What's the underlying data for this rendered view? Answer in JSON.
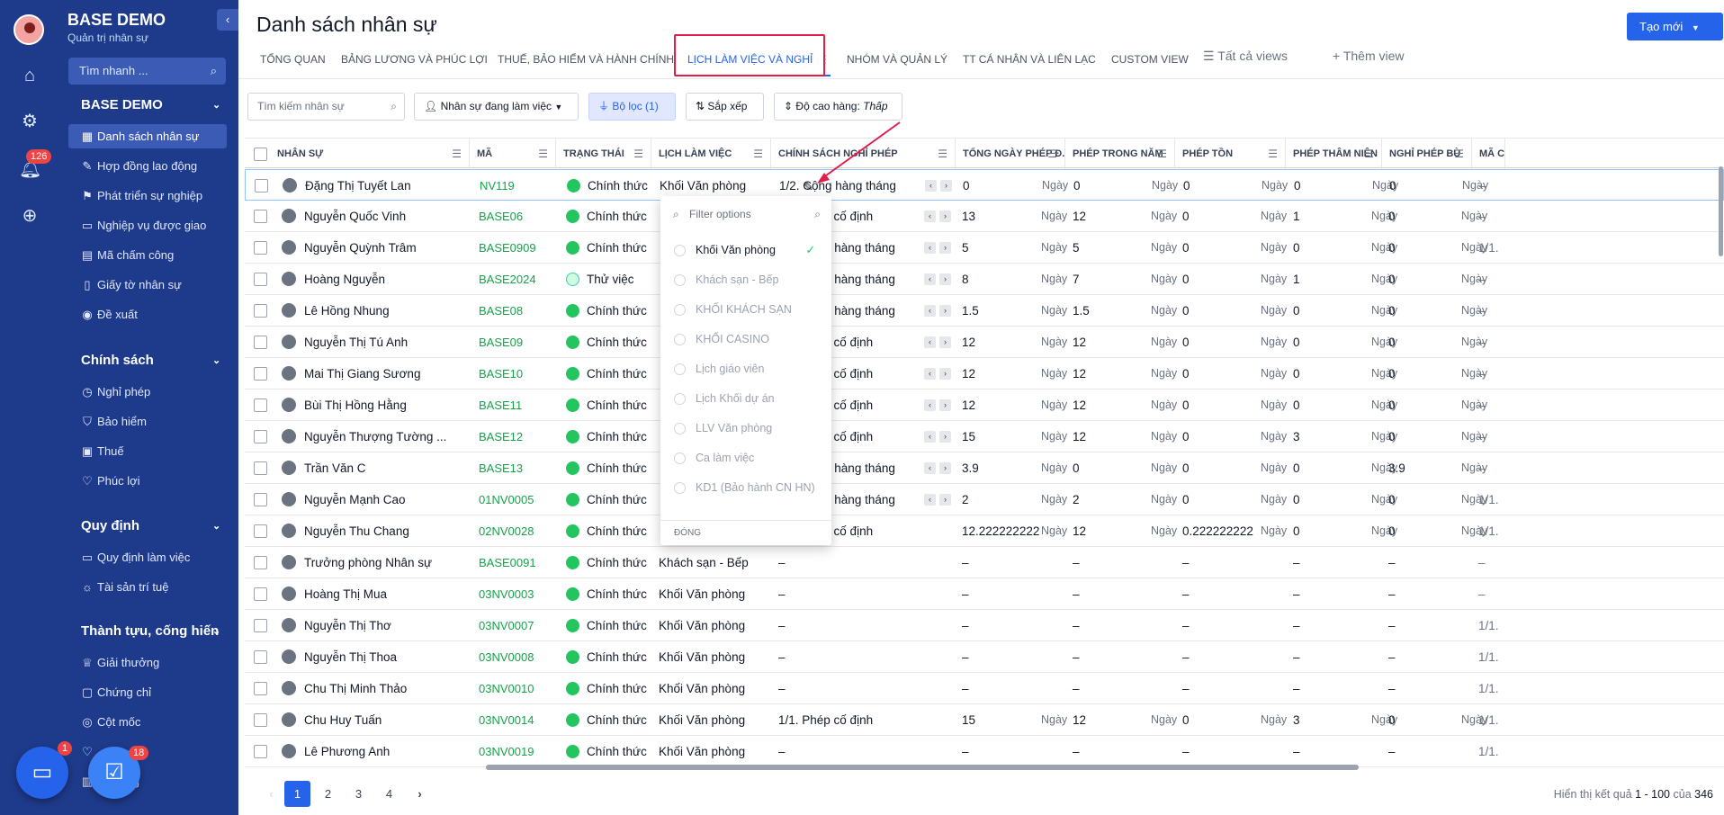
{
  "app": {
    "name": "BASE DEMO",
    "subtitle": "Quản trị nhân sự"
  },
  "rail": {
    "notification_count": "126"
  },
  "sidebar": {
    "search_placeholder": "Tìm nhanh ...",
    "sections": [
      {
        "title": "BASE DEMO",
        "items": [
          {
            "label": "Danh sách nhân sự",
            "icon": "grid-icon",
            "active": true
          },
          {
            "label": "Hợp đồng lao động",
            "icon": "contract-icon"
          },
          {
            "label": "Phát triển sự nghiệp",
            "icon": "flag-icon"
          },
          {
            "label": "Nghiệp vụ được giao",
            "icon": "book-icon"
          },
          {
            "label": "Mã chấm công",
            "icon": "calendar-icon"
          },
          {
            "label": "Giấy tờ nhân sự",
            "icon": "document-icon"
          },
          {
            "label": "Đề xuất",
            "icon": "broadcast-icon"
          }
        ]
      },
      {
        "title": "Chính sách",
        "items": [
          {
            "label": "Nghỉ phép",
            "icon": "clock-icon"
          },
          {
            "label": "Bảo hiểm",
            "icon": "shield-icon"
          },
          {
            "label": "Thuế",
            "icon": "wallet-icon"
          },
          {
            "label": "Phúc lợi",
            "icon": "heart-icon"
          }
        ]
      },
      {
        "title": "Quy định",
        "items": [
          {
            "label": "Quy định làm việc",
            "icon": "book-icon"
          },
          {
            "label": "Tài sản trí tuệ",
            "icon": "idea-icon"
          }
        ]
      },
      {
        "title": "Thành tựu, cống hiến",
        "items": [
          {
            "label": "Giải thưởng",
            "icon": "crown-icon"
          },
          {
            "label": "Chứng chỉ",
            "icon": "certificate-icon"
          },
          {
            "label": "Cột mốc",
            "icon": "target-icon"
          },
          {
            "label": "",
            "icon": "heart-icon"
          },
          {
            "label": "ếp hạng",
            "icon": "ranking-icon"
          }
        ]
      }
    ],
    "fab_chat_badge": "1",
    "fab_task_badge": "18"
  },
  "page": {
    "title": "Danh sách nhân sự",
    "create_label": "Tạo mới"
  },
  "tabs": [
    {
      "label": "TỔNG QUAN"
    },
    {
      "label": "BẢNG LƯƠNG VÀ PHÚC LỢI"
    },
    {
      "label": "THUẾ, BẢO HIỂM VÀ HÀNH CHÍNH"
    },
    {
      "label": "LỊCH LÀM VIỆC VÀ NGHỈ",
      "active": true
    },
    {
      "label": "NHÓM VÀ QUẢN LÝ"
    },
    {
      "label": "TT CÁ NHÂN VÀ LIÊN LẠC"
    },
    {
      "label": "CUSTOM VIEW"
    },
    {
      "label": "Tất cả views"
    },
    {
      "label": "Thêm view"
    }
  ],
  "toolbar": {
    "search_placeholder": "Tìm kiếm nhân sự",
    "status_filter": "Nhân sự đang làm việc",
    "filter_label": "Bộ lọc (1)",
    "sort_label": "Sắp xếp",
    "row_height_label": "Độ cao hàng:",
    "row_height_value": "Thấp"
  },
  "columns": [
    "NHÂN SỰ",
    "MÃ",
    "TRẠNG THÁI",
    "LỊCH LÀM VIỆC",
    "CHÍNH SÁCH NGHỈ PHÉP",
    "TỔNG NGÀY PHÉP Đ...",
    "PHÉP TRONG NĂM",
    "PHÉP TỒN",
    "PHÉP THÂM NIÊN",
    "NGHỈ PHÉP BÙ",
    "MÃ C"
  ],
  "unit_label": "Ngày",
  "rows": [
    {
      "name": "Đặng Thị Tuyết Lan",
      "code": "NV119",
      "status": "Chính thức",
      "schedule": "Khối Văn phòng",
      "policy": "1/2. Cộng hàng tháng",
      "total": "0",
      "year": "0",
      "remain": "0",
      "senior": "0",
      "comp": "0",
      "extra": "–"
    },
    {
      "name": "Nguyễn Quốc Vinh",
      "code": "BASE06",
      "status": "Chính thức",
      "schedule": "",
      "policy": "1/2. Phép cố định",
      "total": "13",
      "year": "12",
      "remain": "0",
      "senior": "1",
      "comp": "0",
      "extra": "–"
    },
    {
      "name": "Nguyễn Quỳnh Trâm",
      "code": "BASE0909",
      "status": "Chính thức",
      "schedule": "",
      "policy": "1/2. Cộng hàng tháng",
      "total": "5",
      "year": "5",
      "remain": "0",
      "senior": "0",
      "comp": "0",
      "extra": "1/1."
    },
    {
      "name": "Hoàng Nguyễn",
      "code": "BASE2024",
      "status": "Thử việc",
      "schedule": "",
      "policy": "1/2. Cộng hàng tháng",
      "total": "8",
      "year": "7",
      "remain": "0",
      "senior": "1",
      "comp": "0",
      "extra": "–"
    },
    {
      "name": "Lê Hồng Nhung",
      "code": "BASE08",
      "status": "Chính thức",
      "schedule": "",
      "policy": "1/2. Cộng hàng tháng",
      "total": "1.5",
      "year": "1.5",
      "remain": "0",
      "senior": "0",
      "comp": "0",
      "extra": "–"
    },
    {
      "name": "Nguyễn Thị Tú Anh",
      "code": "BASE09",
      "status": "Chính thức",
      "schedule": "",
      "policy": "1/2. Phép cố định",
      "total": "12",
      "year": "12",
      "remain": "0",
      "senior": "0",
      "comp": "0",
      "extra": "–"
    },
    {
      "name": "Mai Thị Giang Sương",
      "code": "BASE10",
      "status": "Chính thức",
      "schedule": "",
      "policy": "1/2. Phép cố định",
      "total": "12",
      "year": "12",
      "remain": "0",
      "senior": "0",
      "comp": "0",
      "extra": "–"
    },
    {
      "name": "Bùi Thị Hồng Hằng",
      "code": "BASE11",
      "status": "Chính thức",
      "schedule": "",
      "policy": "1/2. Phép cố định",
      "total": "12",
      "year": "12",
      "remain": "0",
      "senior": "0",
      "comp": "0",
      "extra": "–"
    },
    {
      "name": "Nguyễn Thượng Tường ...",
      "code": "BASE12",
      "status": "Chính thức",
      "schedule": "",
      "policy": "1/2. Phép cố định",
      "total": "15",
      "year": "12",
      "remain": "0",
      "senior": "3",
      "comp": "0",
      "extra": "–"
    },
    {
      "name": "Trần Văn C",
      "code": "BASE13",
      "status": "Chính thức",
      "schedule": "",
      "policy": "1/2. Cộng hàng tháng",
      "total": "3.9",
      "year": "0",
      "remain": "0",
      "senior": "0",
      "comp": "3.9",
      "extra": "–"
    },
    {
      "name": "Nguyễn Mạnh Cao",
      "code": "01NV0005",
      "status": "Chính thức",
      "schedule": "",
      "policy": "1/2. Cộng hàng tháng",
      "total": "2",
      "year": "2",
      "remain": "0",
      "senior": "0",
      "comp": "0",
      "extra": "1/1."
    },
    {
      "name": "Nguyễn Thu Chang",
      "code": "02NV0028",
      "status": "Chính thức",
      "schedule": "",
      "policy": "1/1. Phép cố định",
      "total": "12.222222222",
      "year": "12",
      "remain": "0.222222222",
      "senior": "0",
      "comp": "0",
      "extra": "1/1."
    },
    {
      "name": "Trưởng phòng Nhân sự",
      "code": "BASE0091",
      "status": "Chính thức",
      "schedule": "Khách sạn - Bếp",
      "policy": "–",
      "total": "–",
      "year": "–",
      "remain": "–",
      "senior": "–",
      "comp": "–",
      "extra": "–"
    },
    {
      "name": "Hoàng Thị Mua",
      "code": "03NV0003",
      "status": "Chính thức",
      "schedule": "Khối Văn phòng",
      "policy": "–",
      "total": "–",
      "year": "–",
      "remain": "–",
      "senior": "–",
      "comp": "–",
      "extra": "–"
    },
    {
      "name": "Nguyễn Thị Thơ",
      "code": "03NV0007",
      "status": "Chính thức",
      "schedule": "Khối Văn phòng",
      "policy": "–",
      "total": "–",
      "year": "–",
      "remain": "–",
      "senior": "–",
      "comp": "–",
      "extra": "1/1."
    },
    {
      "name": "Nguyễn Thị Thoa",
      "code": "03NV0008",
      "status": "Chính thức",
      "schedule": "Khối Văn phòng",
      "policy": "–",
      "total": "–",
      "year": "–",
      "remain": "–",
      "senior": "–",
      "comp": "–",
      "extra": "1/1."
    },
    {
      "name": "Chu Thị Minh Thảo",
      "code": "03NV0010",
      "status": "Chính thức",
      "schedule": "Khối Văn phòng",
      "policy": "–",
      "total": "–",
      "year": "–",
      "remain": "–",
      "senior": "–",
      "comp": "–",
      "extra": "1/1."
    },
    {
      "name": "Chu Huy Tuấn",
      "code": "03NV0014",
      "status": "Chính thức",
      "schedule": "Khối Văn phòng",
      "policy": "1/1. Phép cố định",
      "total": "15",
      "year": "12",
      "remain": "0",
      "senior": "3",
      "comp": "0",
      "extra": "1/1."
    },
    {
      "name": "Lê Phương Anh",
      "code": "03NV0019",
      "status": "Chính thức",
      "schedule": "Khối Văn phòng",
      "policy": "–",
      "total": "–",
      "year": "–",
      "remain": "–",
      "senior": "–",
      "comp": "–",
      "extra": "1/1."
    }
  ],
  "dropdown": {
    "placeholder": "Filter options",
    "options": [
      "Khối Văn phòng",
      "Khách sạn - Bếp",
      "KHỐI KHÁCH SẠN",
      "KHỐI CASINO",
      "Lịch giáo viên",
      "Lịch Khối dự án",
      "LLV Văn phòng",
      "Ca làm việc",
      "KD1 (Bảo hành CN HN)"
    ],
    "selected": "Khối Văn phòng",
    "close_label": "ĐÓNG"
  },
  "pagination": {
    "pages": [
      "1",
      "2",
      "3",
      "4"
    ],
    "current": "1",
    "summary_prefix": "Hiển thị kết quả",
    "range": "1 - 100",
    "of": "của",
    "total": "346"
  },
  "colors": {
    "accent": "#2563eb",
    "sidebar": "#1e3a8a",
    "status_green": "#22c55e",
    "highlight": "#e11d48"
  }
}
